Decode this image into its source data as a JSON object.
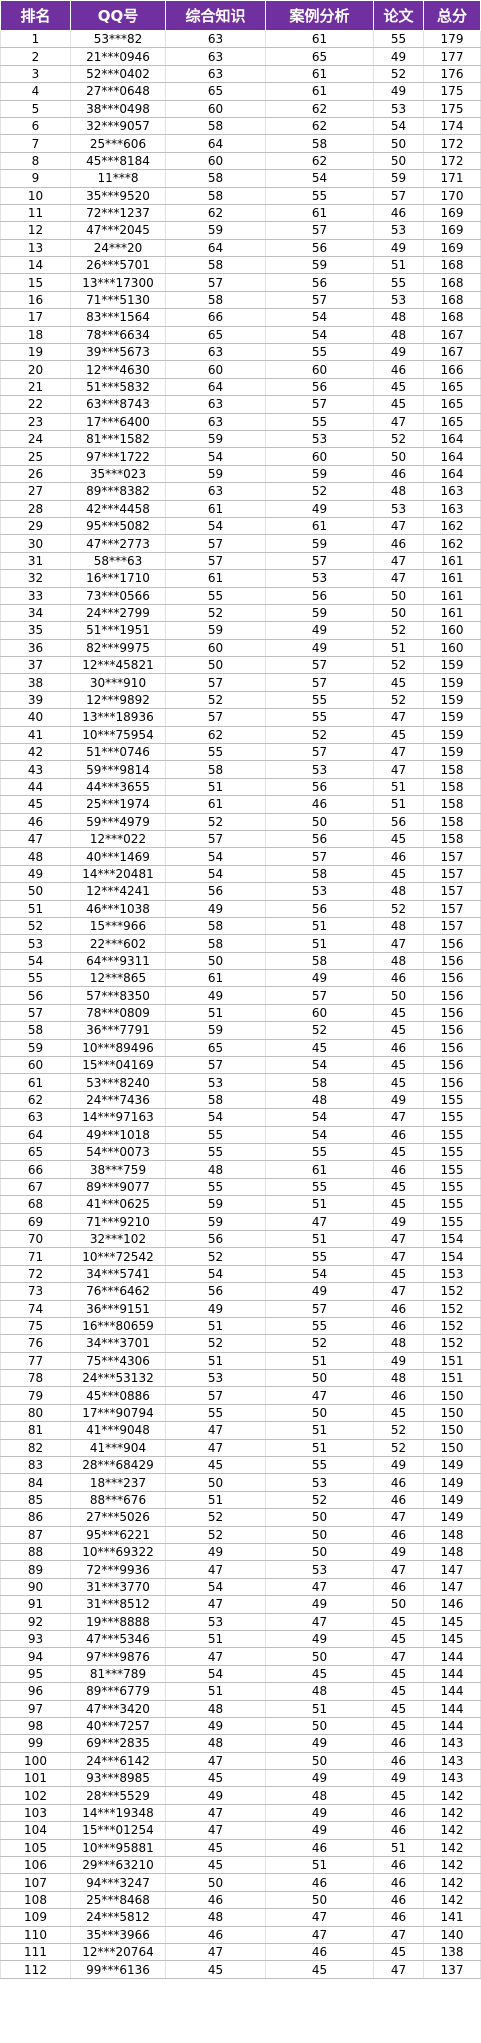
{
  "headers": [
    "排名",
    "QQ号",
    "综合知识",
    "案例分析",
    "论文",
    "总分"
  ],
  "rows": [
    [
      "1",
      "53***82",
      "63",
      "61",
      "55",
      "179"
    ],
    [
      "2",
      "21***0946",
      "63",
      "65",
      "49",
      "177"
    ],
    [
      "3",
      "52***0402",
      "63",
      "61",
      "52",
      "176"
    ],
    [
      "4",
      "27***0648",
      "65",
      "61",
      "49",
      "175"
    ],
    [
      "5",
      "38***0498",
      "60",
      "62",
      "53",
      "175"
    ],
    [
      "6",
      "32***9057",
      "58",
      "62",
      "54",
      "174"
    ],
    [
      "7",
      "25***606",
      "64",
      "58",
      "50",
      "172"
    ],
    [
      "8",
      "45***8184",
      "60",
      "62",
      "50",
      "172"
    ],
    [
      "9",
      "11***8",
      "58",
      "54",
      "59",
      "171"
    ],
    [
      "10",
      "35***9520",
      "58",
      "55",
      "57",
      "170"
    ],
    [
      "11",
      "72***1237",
      "62",
      "61",
      "46",
      "169"
    ],
    [
      "12",
      "47***2045",
      "59",
      "57",
      "53",
      "169"
    ],
    [
      "13",
      "24***20",
      "64",
      "56",
      "49",
      "169"
    ],
    [
      "14",
      "26***5701",
      "58",
      "59",
      "51",
      "168"
    ],
    [
      "15",
      "13***17300",
      "57",
      "56",
      "55",
      "168"
    ],
    [
      "16",
      "71***5130",
      "58",
      "57",
      "53",
      "168"
    ],
    [
      "17",
      "83***1564",
      "66",
      "54",
      "48",
      "168"
    ],
    [
      "18",
      "78***6634",
      "65",
      "54",
      "48",
      "167"
    ],
    [
      "19",
      "39***5673",
      "63",
      "55",
      "49",
      "167"
    ],
    [
      "20",
      "12***4630",
      "60",
      "60",
      "46",
      "166"
    ],
    [
      "21",
      "51***5832",
      "64",
      "56",
      "45",
      "165"
    ],
    [
      "22",
      "63***8743",
      "63",
      "57",
      "45",
      "165"
    ],
    [
      "23",
      "17***6400",
      "63",
      "55",
      "47",
      "165"
    ],
    [
      "24",
      "81***1582",
      "59",
      "53",
      "52",
      "164"
    ],
    [
      "25",
      "97***1722",
      "54",
      "60",
      "50",
      "164"
    ],
    [
      "26",
      "35***023",
      "59",
      "59",
      "46",
      "164"
    ],
    [
      "27",
      "89***8382",
      "63",
      "52",
      "48",
      "163"
    ],
    [
      "28",
      "42***4458",
      "61",
      "49",
      "53",
      "163"
    ],
    [
      "29",
      "95***5082",
      "54",
      "61",
      "47",
      "162"
    ],
    [
      "30",
      "47***2773",
      "57",
      "59",
      "46",
      "162"
    ],
    [
      "31",
      "58***63",
      "57",
      "57",
      "47",
      "161"
    ],
    [
      "32",
      "16***1710",
      "61",
      "53",
      "47",
      "161"
    ],
    [
      "33",
      "73***0566",
      "55",
      "56",
      "50",
      "161"
    ],
    [
      "34",
      "24***2799",
      "52",
      "59",
      "50",
      "161"
    ],
    [
      "35",
      "51***1951",
      "59",
      "49",
      "52",
      "160"
    ],
    [
      "36",
      "82***9975",
      "60",
      "49",
      "51",
      "160"
    ],
    [
      "37",
      "12***45821",
      "50",
      "57",
      "52",
      "159"
    ],
    [
      "38",
      "30***910",
      "57",
      "57",
      "45",
      "159"
    ],
    [
      "39",
      "12***9892",
      "52",
      "55",
      "52",
      "159"
    ],
    [
      "40",
      "13***18936",
      "57",
      "55",
      "47",
      "159"
    ],
    [
      "41",
      "10***75954",
      "62",
      "52",
      "45",
      "159"
    ],
    [
      "42",
      "51***0746",
      "55",
      "57",
      "47",
      "159"
    ],
    [
      "43",
      "59***9814",
      "58",
      "53",
      "47",
      "158"
    ],
    [
      "44",
      "44***3655",
      "51",
      "56",
      "51",
      "158"
    ],
    [
      "45",
      "25***1974",
      "61",
      "46",
      "51",
      "158"
    ],
    [
      "46",
      "59***4979",
      "52",
      "50",
      "56",
      "158"
    ],
    [
      "47",
      "12***022",
      "57",
      "56",
      "45",
      "158"
    ],
    [
      "48",
      "40***1469",
      "54",
      "57",
      "46",
      "157"
    ],
    [
      "49",
      "14***20481",
      "54",
      "58",
      "45",
      "157"
    ],
    [
      "50",
      "12***4241",
      "56",
      "53",
      "48",
      "157"
    ],
    [
      "51",
      "46***1038",
      "49",
      "56",
      "52",
      "157"
    ],
    [
      "52",
      "15***966",
      "58",
      "51",
      "48",
      "157"
    ],
    [
      "53",
      "22***602",
      "58",
      "51",
      "47",
      "156"
    ],
    [
      "54",
      "64***9311",
      "50",
      "58",
      "48",
      "156"
    ],
    [
      "55",
      "12***865",
      "61",
      "49",
      "46",
      "156"
    ],
    [
      "56",
      "57***8350",
      "49",
      "57",
      "50",
      "156"
    ],
    [
      "57",
      "78***0809",
      "51",
      "60",
      "45",
      "156"
    ],
    [
      "58",
      "36***7791",
      "59",
      "52",
      "45",
      "156"
    ],
    [
      "59",
      "10***89496",
      "65",
      "45",
      "46",
      "156"
    ],
    [
      "60",
      "15***04169",
      "57",
      "54",
      "45",
      "156"
    ],
    [
      "61",
      "53***8240",
      "53",
      "58",
      "45",
      "156"
    ],
    [
      "62",
      "24***7436",
      "58",
      "48",
      "49",
      "155"
    ],
    [
      "63",
      "14***97163",
      "54",
      "54",
      "47",
      "155"
    ],
    [
      "64",
      "49***1018",
      "55",
      "54",
      "46",
      "155"
    ],
    [
      "65",
      "54***0073",
      "55",
      "55",
      "45",
      "155"
    ],
    [
      "66",
      "38***759",
      "48",
      "61",
      "46",
      "155"
    ],
    [
      "67",
      "89***9077",
      "55",
      "55",
      "45",
      "155"
    ],
    [
      "68",
      "41***0625",
      "59",
      "51",
      "45",
      "155"
    ],
    [
      "69",
      "71***9210",
      "59",
      "47",
      "49",
      "155"
    ],
    [
      "70",
      "32***102",
      "56",
      "51",
      "47",
      "154"
    ],
    [
      "71",
      "10***72542",
      "52",
      "55",
      "47",
      "154"
    ],
    [
      "72",
      "34***5741",
      "54",
      "54",
      "45",
      "153"
    ],
    [
      "73",
      "76***6462",
      "56",
      "49",
      "47",
      "152"
    ],
    [
      "74",
      "36***9151",
      "49",
      "57",
      "46",
      "152"
    ],
    [
      "75",
      "16***80659",
      "51",
      "55",
      "46",
      "152"
    ],
    [
      "76",
      "34***3701",
      "52",
      "52",
      "48",
      "152"
    ],
    [
      "77",
      "75***4306",
      "51",
      "51",
      "49",
      "151"
    ],
    [
      "78",
      "24***53132",
      "53",
      "50",
      "48",
      "151"
    ],
    [
      "79",
      "45***0886",
      "57",
      "47",
      "46",
      "150"
    ],
    [
      "80",
      "17***90794",
      "55",
      "50",
      "45",
      "150"
    ],
    [
      "81",
      "41***9048",
      "47",
      "51",
      "52",
      "150"
    ],
    [
      "82",
      "41***904",
      "47",
      "51",
      "52",
      "150"
    ],
    [
      "83",
      "28***68429",
      "45",
      "55",
      "49",
      "149"
    ],
    [
      "84",
      "18***237",
      "50",
      "53",
      "46",
      "149"
    ],
    [
      "85",
      "88***676",
      "51",
      "52",
      "46",
      "149"
    ],
    [
      "86",
      "27***5026",
      "52",
      "50",
      "47",
      "149"
    ],
    [
      "87",
      "95***6221",
      "52",
      "50",
      "46",
      "148"
    ],
    [
      "88",
      "10***69322",
      "49",
      "50",
      "49",
      "148"
    ],
    [
      "89",
      "72***9936",
      "47",
      "53",
      "47",
      "147"
    ],
    [
      "90",
      "31***3770",
      "54",
      "47",
      "46",
      "147"
    ],
    [
      "91",
      "31***8512",
      "47",
      "49",
      "50",
      "146"
    ],
    [
      "92",
      "19***8888",
      "53",
      "47",
      "45",
      "145"
    ],
    [
      "93",
      "47***5346",
      "51",
      "49",
      "45",
      "145"
    ],
    [
      "94",
      "97***9876",
      "47",
      "50",
      "47",
      "144"
    ],
    [
      "95",
      "81***789",
      "54",
      "45",
      "45",
      "144"
    ],
    [
      "96",
      "89***6779",
      "51",
      "48",
      "45",
      "144"
    ],
    [
      "97",
      "47***3420",
      "48",
      "51",
      "45",
      "144"
    ],
    [
      "98",
      "40***7257",
      "49",
      "50",
      "45",
      "144"
    ],
    [
      "99",
      "69***2835",
      "48",
      "49",
      "46",
      "143"
    ],
    [
      "100",
      "24***6142",
      "47",
      "50",
      "46",
      "143"
    ],
    [
      "101",
      "93***8985",
      "45",
      "49",
      "49",
      "143"
    ],
    [
      "102",
      "28***5529",
      "49",
      "48",
      "45",
      "142"
    ],
    [
      "103",
      "14***19348",
      "47",
      "49",
      "46",
      "142"
    ],
    [
      "104",
      "15***01254",
      "47",
      "49",
      "46",
      "142"
    ],
    [
      "105",
      "10***95881",
      "45",
      "46",
      "51",
      "142"
    ],
    [
      "106",
      "29***63210",
      "45",
      "51",
      "46",
      "142"
    ],
    [
      "107",
      "94***3247",
      "50",
      "46",
      "46",
      "142"
    ],
    [
      "108",
      "25***8468",
      "46",
      "50",
      "46",
      "142"
    ],
    [
      "109",
      "24***5812",
      "48",
      "47",
      "46",
      "141"
    ],
    [
      "110",
      "35***3966",
      "46",
      "47",
      "47",
      "140"
    ],
    [
      "111",
      "12***20764",
      "47",
      "46",
      "45",
      "138"
    ],
    [
      "112",
      "99***6136",
      "45",
      "45",
      "47",
      "137"
    ]
  ]
}
